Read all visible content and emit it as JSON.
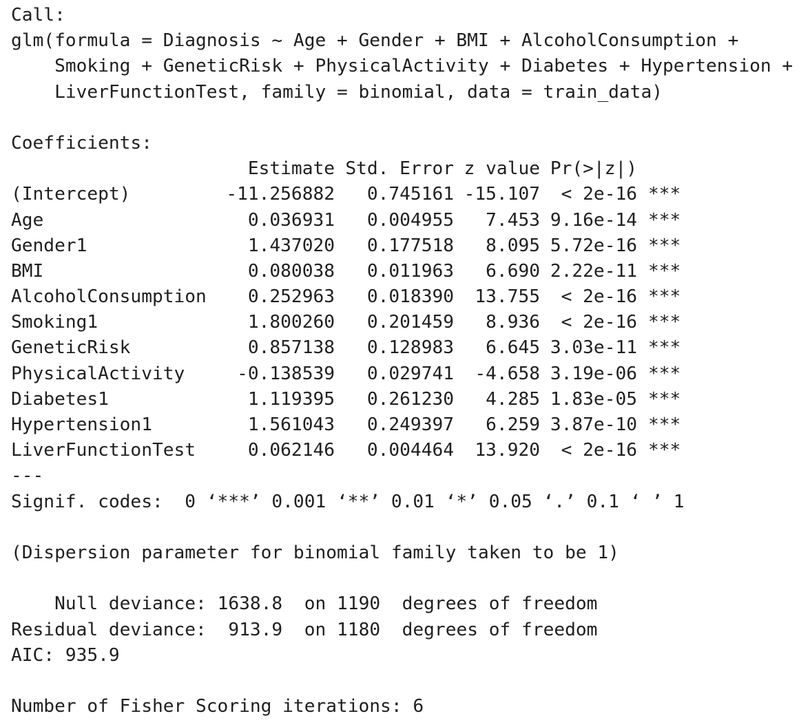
{
  "call": {
    "heading": "Call:",
    "lines": [
      "glm(formula = Diagnosis ~ Age + Gender + BMI + AlcoholConsumption +",
      "    Smoking + GeneticRisk + PhysicalActivity + Diabetes + Hypertension +",
      "    LiverFunctionTest, family = binomial, data = train_data)"
    ]
  },
  "coefficients": {
    "heading": "Coefficients:",
    "headers": [
      "Estimate",
      "Std. Error",
      "z value",
      "Pr(>|z|)"
    ],
    "rows": [
      {
        "name": "(Intercept)",
        "estimate": "-11.256882",
        "std_error": "0.745161",
        "z_value": "-15.107",
        "p_value": "< 2e-16",
        "signif": "***"
      },
      {
        "name": "Age",
        "estimate": "0.036931",
        "std_error": "0.004955",
        "z_value": "7.453",
        "p_value": "9.16e-14",
        "signif": "***"
      },
      {
        "name": "Gender1",
        "estimate": "1.437020",
        "std_error": "0.177518",
        "z_value": "8.095",
        "p_value": "5.72e-16",
        "signif": "***"
      },
      {
        "name": "BMI",
        "estimate": "0.080038",
        "std_error": "0.011963",
        "z_value": "6.690",
        "p_value": "2.22e-11",
        "signif": "***"
      },
      {
        "name": "AlcoholConsumption",
        "estimate": "0.252963",
        "std_error": "0.018390",
        "z_value": "13.755",
        "p_value": "< 2e-16",
        "signif": "***"
      },
      {
        "name": "Smoking1",
        "estimate": "1.800260",
        "std_error": "0.201459",
        "z_value": "8.936",
        "p_value": "< 2e-16",
        "signif": "***"
      },
      {
        "name": "GeneticRisk",
        "estimate": "0.857138",
        "std_error": "0.128983",
        "z_value": "6.645",
        "p_value": "3.03e-11",
        "signif": "***"
      },
      {
        "name": "PhysicalActivity",
        "estimate": "-0.138539",
        "std_error": "0.029741",
        "z_value": "-4.658",
        "p_value": "3.19e-06",
        "signif": "***"
      },
      {
        "name": "Diabetes1",
        "estimate": "1.119395",
        "std_error": "0.261230",
        "z_value": "4.285",
        "p_value": "1.83e-05",
        "signif": "***"
      },
      {
        "name": "Hypertension1",
        "estimate": "1.561043",
        "std_error": "0.249397",
        "z_value": "6.259",
        "p_value": "3.87e-10",
        "signif": "***"
      },
      {
        "name": "LiverFunctionTest",
        "estimate": "0.062146",
        "std_error": "0.004464",
        "z_value": "13.920",
        "p_value": "< 2e-16",
        "signif": "***"
      }
    ],
    "separator": "---",
    "signif_codes": "Signif. codes:  0 ‘***’ 0.001 ‘**’ 0.01 ‘*’ 0.05 ‘.’ 0.1 ‘ ’ 1"
  },
  "dispersion": "(Dispersion parameter for binomial family taken to be 1)",
  "deviance": {
    "null_label": "    Null deviance:",
    "null_value": "1638.8",
    "null_df_text": "on 1190  degrees of freedom",
    "residual_label": "Residual deviance:",
    "residual_value": "913.9",
    "residual_df_text": "on 1180  degrees of freedom",
    "aic": "AIC: 935.9"
  },
  "fisher": "Number of Fisher Scoring iterations: 6"
}
